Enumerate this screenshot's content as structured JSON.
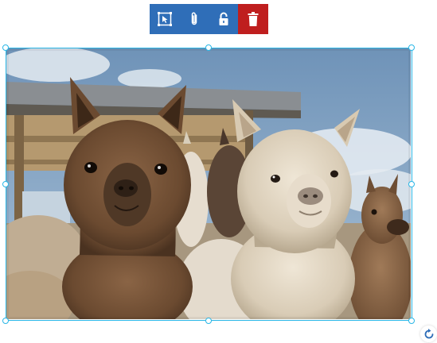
{
  "colors": {
    "toolbar_background": "#2f6eb8",
    "toolbar_danger": "#bf1e1e",
    "selection_outline": "#29b6e6",
    "icon_foreground": "#ffffff"
  },
  "toolbar": {
    "buttons": [
      {
        "icon": "crop-select-icon",
        "action": "select-region"
      },
      {
        "icon": "paperclip-icon",
        "action": "attach"
      },
      {
        "icon": "unlock-icon",
        "action": "lock-toggle"
      },
      {
        "icon": "trash-icon",
        "action": "delete"
      }
    ]
  },
  "image": {
    "subject": "alpacas photo",
    "selected": true,
    "resize_handles": [
      "top-left",
      "top",
      "top-right",
      "left",
      "right",
      "bottom-left",
      "bottom",
      "bottom-right"
    ]
  },
  "rotate_control": {
    "icon": "rotate-icon"
  }
}
